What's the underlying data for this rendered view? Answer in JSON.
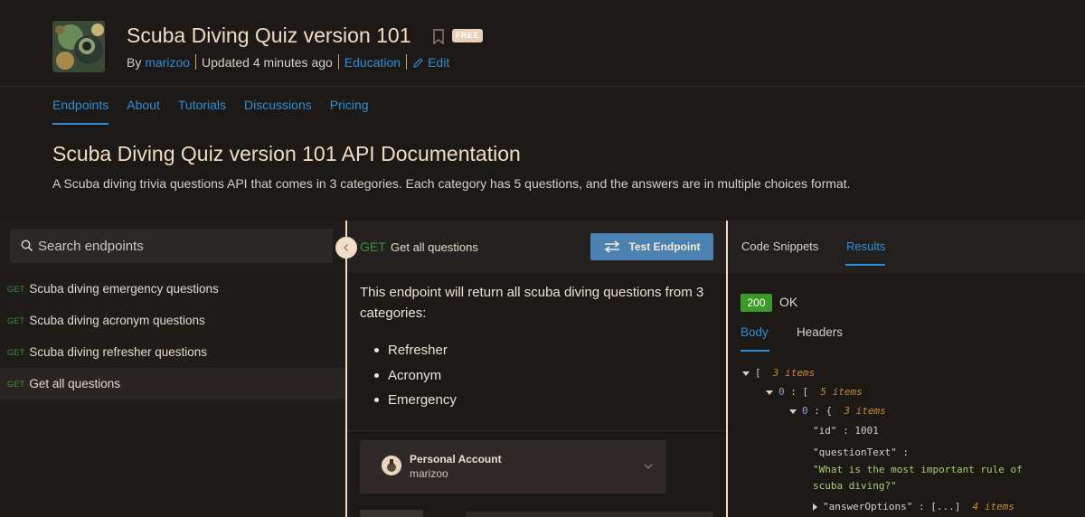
{
  "header": {
    "title": "Scuba Diving Quiz version 101",
    "badge": "FREE",
    "by_label": "By",
    "author": "marizoo",
    "updated": "Updated 4 minutes ago",
    "category": "Education",
    "edit_label": "Edit"
  },
  "tabs": [
    {
      "label": "Endpoints"
    },
    {
      "label": "About"
    },
    {
      "label": "Tutorials"
    },
    {
      "label": "Discussions"
    },
    {
      "label": "Pricing"
    }
  ],
  "doc": {
    "title": "Scuba Diving Quiz version 101 API Documentation",
    "description": "A Scuba diving trivia questions API that comes in 3 categories. Each category has 5 questions, and the answers are in multiple choices format."
  },
  "search": {
    "placeholder": "Search endpoints"
  },
  "endpoints": [
    {
      "method": "GET",
      "label": "Scuba diving emergency questions"
    },
    {
      "method": "GET",
      "label": "Scuba diving acronym questions"
    },
    {
      "method": "GET",
      "label": "Scuba diving refresher questions"
    },
    {
      "method": "GET",
      "label": "Get all questions"
    }
  ],
  "selected_endpoint": {
    "method": "GET",
    "name": "Get all questions",
    "test_button": "Test Endpoint",
    "description": "This endpoint will return all scuba diving questions from 3 categories:",
    "categories": [
      "Refresher",
      "Acronym",
      "Emergency"
    ]
  },
  "account": {
    "name": "Personal Account",
    "user": "marizoo"
  },
  "results_panel": {
    "tabs": [
      "Code Snippets",
      "Results"
    ],
    "status_code": "200",
    "status_text": "OK",
    "body_tabs": [
      "Body",
      "Headers"
    ],
    "json": {
      "root_open": "[",
      "root_count": "3 items",
      "idx0": "0",
      "colon": ":",
      "arr_open": "[",
      "arr_count": "5 items",
      "obj_open": "{",
      "obj_count": "3 items",
      "id_key": "\"id\"",
      "id_value": "1001",
      "question_key": "\"questionText\"",
      "question_value_1": "\"What is the most important rule of",
      "question_value_2": "scuba diving?\"",
      "answer_key": "\"answerOptions\"",
      "answer_collapsed": "[...]",
      "answer_count": "4 items"
    }
  },
  "colors": {
    "accent": "#2f8fd6",
    "get_green": "#3e8f3e",
    "status_green": "#3d9a2a",
    "test_button": "#4b82b2"
  }
}
